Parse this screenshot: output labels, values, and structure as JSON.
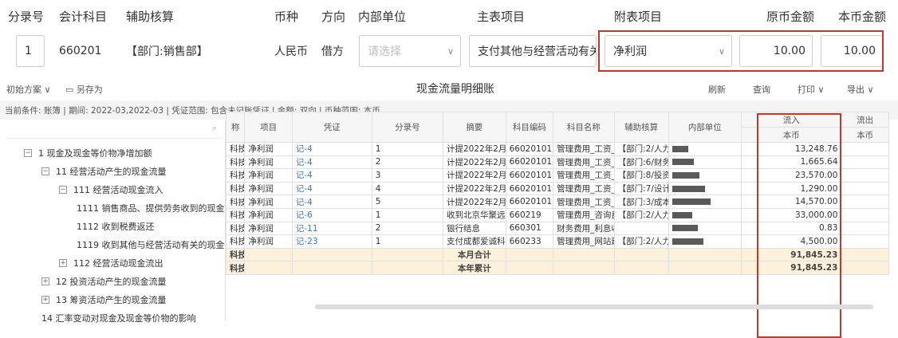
{
  "entry_header": {
    "columns": [
      "分录号",
      "会计科目",
      "辅助核算",
      "币种",
      "方向",
      "内部单位",
      "主表项目",
      "附表项目",
      "原币金额",
      "本币金额"
    ]
  },
  "entry_row": {
    "seq": "1",
    "account": "660201",
    "aux": "【部门:销售部】",
    "currency": "人民币",
    "direction": "借方",
    "internal_unit_placeholder": "请选择",
    "main_item": "支付其他与经营活动有关...",
    "sub_item": "净利润",
    "orig_amount": "10.00",
    "local_amount": "10.00"
  },
  "toolbar": {
    "scheme": "初始方案",
    "save_as": "另存为",
    "title": "现金流量明细账",
    "refresh": "刷新",
    "query": "查询",
    "print": "打印",
    "export": "导出"
  },
  "conditions": "当前条件: 账簿                       | 期间: 2022-03,2022-03 | 凭证范围: 包含未记账凭证 | 金额: 双向 | 币种范围: 本币",
  "tree": [
    {
      "label": "1 现金及现金等价物净增加额",
      "toggle": "−",
      "indent": 0
    },
    {
      "label": "11 经营活动产生的现金流量",
      "toggle": "−",
      "indent": 1
    },
    {
      "label": "111 经营活动现金流入",
      "toggle": "−",
      "indent": 2
    },
    {
      "label": "1111 销售商品、提供劳务收到的现金",
      "toggle": "",
      "indent": 3
    },
    {
      "label": "1112 收到税费返还",
      "toggle": "",
      "indent": 3
    },
    {
      "label": "1119 收到其他与经营活动有关的现金",
      "toggle": "",
      "indent": 3
    },
    {
      "label": "112 经营活动现金流出",
      "toggle": "+",
      "indent": 2
    },
    {
      "label": "12 投资活动产生的现金流量",
      "toggle": "+",
      "indent": 1
    },
    {
      "label": "13 筹资活动产生的现金流量",
      "toggle": "+",
      "indent": 1
    },
    {
      "label": "14 汇率变动对现金及现金等价物的影响",
      "toggle": "",
      "indent": 1
    }
  ],
  "grid_header": {
    "cols": [
      "称",
      "项目",
      "凭证",
      "分录号",
      "摘要",
      "科目编码",
      "科目名称",
      "辅助核算",
      "内部单位",
      "流入",
      "流出"
    ],
    "sub_in": "本币",
    "sub_out": "本币"
  },
  "rows": [
    {
      "c0": "科技",
      "item": "净利润",
      "voucher": "记-4",
      "seq": "1",
      "summary": "计提2022年2月员",
      "code": "66020101",
      "name": "管理费用_工资_职",
      "aux": "【部门:2/人力行政",
      "inflow": "13,248.76"
    },
    {
      "c0": "科技",
      "item": "净利润",
      "voucher": "记-4",
      "seq": "2",
      "summary": "计提2022年2月员",
      "code": "66020101",
      "name": "管理费用_工资_职",
      "aux": "【部门:6/财务管理",
      "inflow": "1,665.64"
    },
    {
      "c0": "科技",
      "item": "净利润",
      "voucher": "记-4",
      "seq": "3",
      "summary": "计提2022年2月员",
      "code": "66020101",
      "name": "管理费用_工资_职",
      "aux": "【部门:8/投资拓展",
      "inflow": "23,570.00"
    },
    {
      "c0": "科技",
      "item": "净利润",
      "voucher": "记-4",
      "seq": "4",
      "summary": "计提2022年2月员",
      "code": "66020101",
      "name": "管理费用_工资_职",
      "aux": "【部门:7/设计管理",
      "inflow": "1,290.00"
    },
    {
      "c0": "科技",
      "item": "净利润",
      "voucher": "记-4",
      "seq": "5",
      "summary": "计提2022年2月员",
      "code": "66020101",
      "name": "管理费用_工资_职",
      "aux": "【部门:3/成本控制",
      "inflow": "14,570.00"
    },
    {
      "c0": "科技",
      "item": "净利润",
      "voucher": "记-6",
      "seq": "1",
      "summary": "收到北京华聚远航",
      "code": "660219",
      "name": "管理费用_咨询费",
      "aux": "【部门:2/人力行",
      "inflow": "33,000.00"
    },
    {
      "c0": "科技",
      "item": "净利润",
      "voucher": "记-11",
      "seq": "2",
      "summary": "银行结息",
      "code": "660301",
      "name": "财务费用_利息收入",
      "aux": "",
      "inflow": "0.83"
    },
    {
      "c0": "科技",
      "item": "净利润",
      "voucher": "记-23",
      "seq": "1",
      "summary": "支付成都爱诚科技",
      "code": "660233",
      "name": "管理费用_网站建设",
      "aux": "【部门:2/人力行政",
      "inflow": "4,500.00"
    }
  ],
  "totals": [
    {
      "c0": "科技",
      "label": "本月合计",
      "inflow": "91,845.23"
    },
    {
      "c0": "科技",
      "label": "本年累计",
      "inflow": "91,845.23"
    }
  ],
  "colors": {
    "highlight": "#c0392b",
    "link": "#3a7bd5",
    "sum_bg": "#fdf1dc"
  }
}
